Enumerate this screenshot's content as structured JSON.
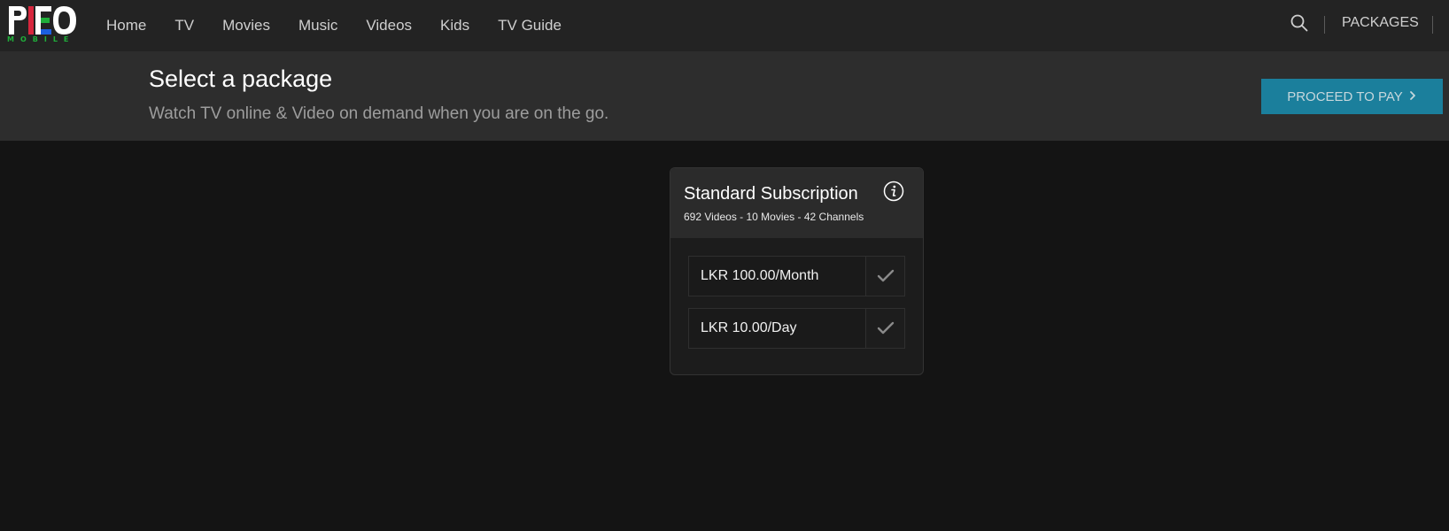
{
  "logo": {
    "wordmark": "PEO",
    "subtitle": "MOBILE",
    "colors": {
      "red": "#d7263d",
      "green": "#1fae3a",
      "blue": "#1c5fe0"
    }
  },
  "nav": {
    "items": [
      {
        "label": "Home"
      },
      {
        "label": "TV"
      },
      {
        "label": "Movies"
      },
      {
        "label": "Music"
      },
      {
        "label": "Videos"
      },
      {
        "label": "Kids"
      },
      {
        "label": "TV Guide"
      }
    ],
    "search_icon": "search-icon",
    "packages_label": "PACKAGES"
  },
  "banner": {
    "title": "Select a package",
    "subtitle": "Watch TV online & Video on demand when you are on the go.",
    "cta_label": "PROCEED TO PAY",
    "cta_color": "#1b7f9c"
  },
  "package": {
    "title": "Standard Subscription",
    "meta": "692 Videos - 10 Movies - 42 Channels",
    "options": [
      {
        "label": "LKR 100.00/Month"
      },
      {
        "label": "LKR 10.00/Day"
      }
    ]
  }
}
